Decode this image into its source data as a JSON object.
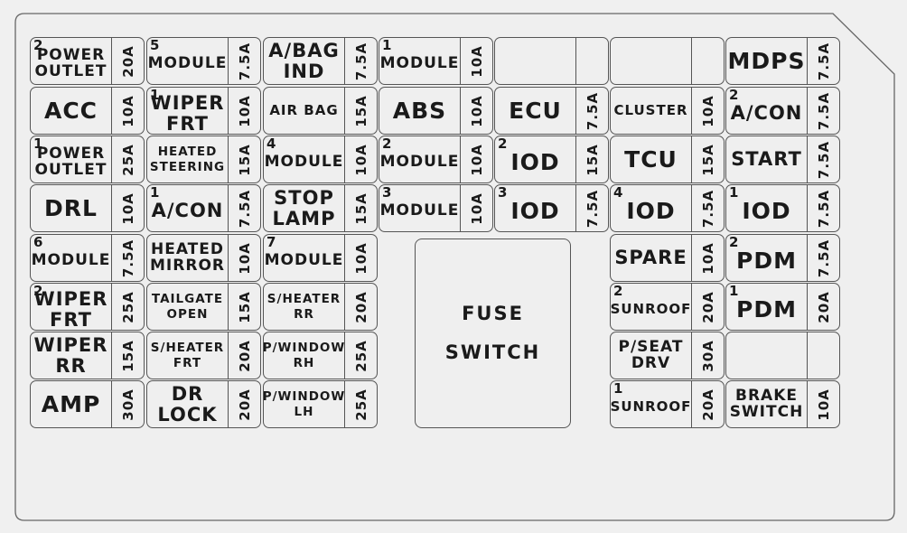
{
  "fuse_switch": {
    "line1": "FUSE",
    "line2": "SWITCH"
  },
  "rows": [
    [
      {
        "num": "2",
        "label": "POWER\nOUTLET",
        "amp": "20A"
      },
      {
        "num": "5",
        "label": "MODULE",
        "amp": "7.5A"
      },
      {
        "num": "",
        "label": "A/BAG\nIND",
        "amp": "7.5A"
      },
      {
        "num": "1",
        "label": "MODULE",
        "amp": "10A"
      },
      {
        "num": "",
        "label": "",
        "amp": ""
      },
      {
        "num": "",
        "label": "",
        "amp": ""
      },
      {
        "num": "",
        "label": "MDPS",
        "amp": "7.5A"
      }
    ],
    [
      {
        "num": "",
        "label": "ACC",
        "amp": "10A"
      },
      {
        "num": "1",
        "label": "WIPER\nFRT",
        "amp": "10A"
      },
      {
        "num": "",
        "label": "AIR BAG",
        "amp": "15A"
      },
      {
        "num": "",
        "label": "ABS",
        "amp": "10A"
      },
      {
        "num": "",
        "label": "ECU",
        "amp": "7.5A"
      },
      {
        "num": "",
        "label": "CLUSTER",
        "amp": "10A"
      },
      {
        "num": "2",
        "label": "A/CON",
        "amp": "7.5A"
      }
    ],
    [
      {
        "num": "1",
        "label": "POWER\nOUTLET",
        "amp": "25A"
      },
      {
        "num": "",
        "label": "HEATED\nSTEERING",
        "amp": "15A"
      },
      {
        "num": "4",
        "label": "MODULE",
        "amp": "10A"
      },
      {
        "num": "2",
        "label": "MODULE",
        "amp": "10A"
      },
      {
        "num": "2",
        "label": "IOD",
        "amp": "15A"
      },
      {
        "num": "",
        "label": "TCU",
        "amp": "15A"
      },
      {
        "num": "",
        "label": "START",
        "amp": "7.5A"
      }
    ],
    [
      {
        "num": "",
        "label": "DRL",
        "amp": "10A"
      },
      {
        "num": "1",
        "label": "A/CON",
        "amp": "7.5A"
      },
      {
        "num": "",
        "label": "STOP\nLAMP",
        "amp": "15A"
      },
      {
        "num": "3",
        "label": "MODULE",
        "amp": "10A"
      },
      {
        "num": "3",
        "label": "IOD",
        "amp": "7.5A"
      },
      {
        "num": "4",
        "label": "IOD",
        "amp": "7.5A"
      },
      {
        "num": "1",
        "label": "IOD",
        "amp": "7.5A"
      }
    ],
    [
      {
        "num": "6",
        "label": "MODULE",
        "amp": "7.5A"
      },
      {
        "num": "",
        "label": "HEATED\nMIRROR",
        "amp": "10A"
      },
      {
        "num": "7",
        "label": "MODULE",
        "amp": "10A"
      },
      null,
      null,
      {
        "num": "",
        "label": "SPARE",
        "amp": "10A"
      },
      {
        "num": "2",
        "label": "PDM",
        "amp": "7.5A"
      }
    ],
    [
      {
        "num": "2",
        "label": "WIPER\nFRT",
        "amp": "25A"
      },
      {
        "num": "",
        "label": "TAILGATE\nOPEN",
        "amp": "15A"
      },
      {
        "num": "",
        "label": "S/HEATER\nRR",
        "amp": "20A"
      },
      null,
      null,
      {
        "num": "2",
        "label": "SUNROOF",
        "amp": "20A"
      },
      {
        "num": "1",
        "label": "PDM",
        "amp": "20A"
      }
    ],
    [
      {
        "num": "",
        "label": "WIPER\nRR",
        "amp": "15A"
      },
      {
        "num": "",
        "label": "S/HEATER\nFRT",
        "amp": "20A"
      },
      {
        "num": "",
        "label": "P/WINDOW\nRH",
        "amp": "25A"
      },
      null,
      null,
      {
        "num": "",
        "label": "P/SEAT\nDRV",
        "amp": "30A"
      },
      {
        "num": "",
        "label": "",
        "amp": ""
      }
    ],
    [
      {
        "num": "",
        "label": "AMP",
        "amp": "30A"
      },
      {
        "num": "",
        "label": "DR\nLOCK",
        "amp": "20A"
      },
      {
        "num": "",
        "label": "P/WINDOW\nLH",
        "amp": "25A"
      },
      null,
      null,
      {
        "num": "1",
        "label": "SUNROOF",
        "amp": "20A"
      },
      {
        "num": "",
        "label": "BRAKE\nSWITCH",
        "amp": "10A"
      }
    ]
  ]
}
